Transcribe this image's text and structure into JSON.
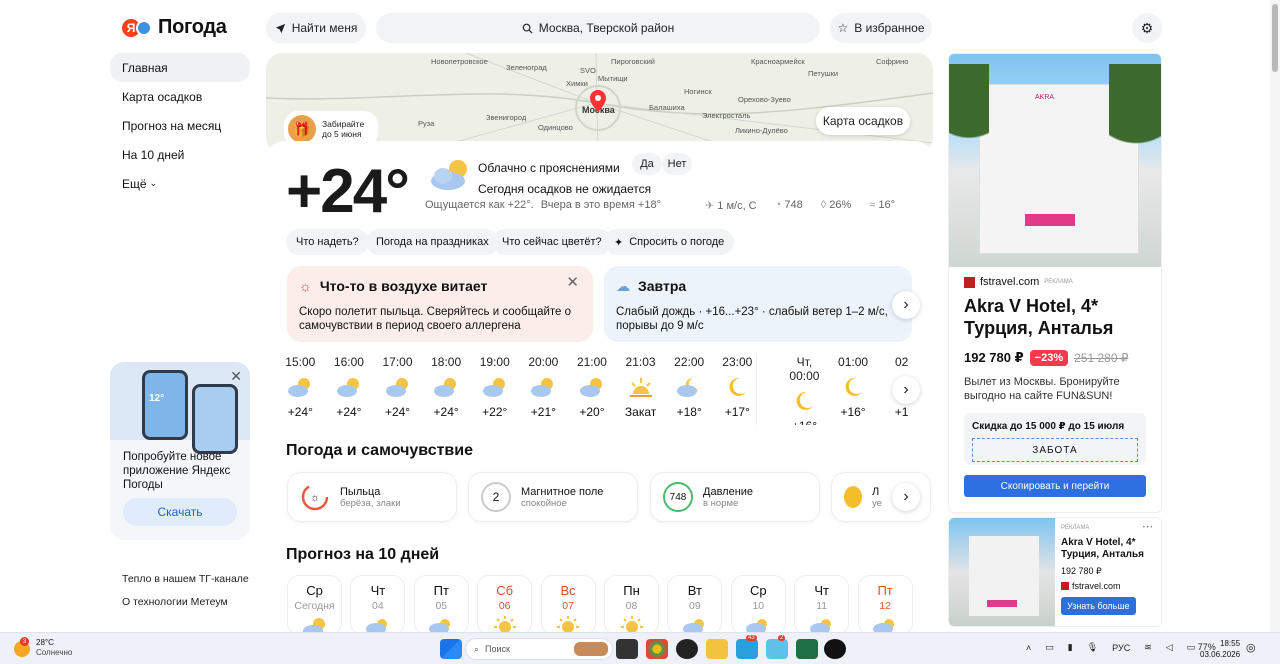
{
  "header": {
    "logo_ya": "Я",
    "logo_text": "Погода",
    "find_me": "Найти меня",
    "search_value": "Москва, Тверской район",
    "favorites": "В избранное"
  },
  "nav": {
    "items": [
      "Главная",
      "Карта осадков",
      "Прогноз на месяц",
      "На 10 дней",
      "Ещё"
    ]
  },
  "promo": {
    "phone_temp": "12°",
    "text": "Попробуйте новое приложение Яндекс Погоды",
    "button": "Скачать"
  },
  "footer_links": [
    "Тепло в нашем ТГ-канале",
    "О технологии Метеум"
  ],
  "map": {
    "labels": [
      "Новопетровское",
      "Зеленоград",
      "Пироговский",
      "Софрино",
      "Красноармейск",
      "SVO",
      "Химки",
      "Мытищи",
      "Петушки",
      "Ногинск",
      "Москва",
      "Балашиха",
      "Орехово-Зуево",
      "Руза",
      "Звенигород",
      "Одинцово",
      "Электросталь",
      "Ликино-Дулёво"
    ],
    "pin_label": "Москва",
    "button": "Карта осадков",
    "badge_text": "Забирайте до 5 июня"
  },
  "current": {
    "temp": "+24°",
    "condition": "Облачно с прояснениями",
    "yes": "Да",
    "no": "Нет",
    "precip": "Сегодня осадков не ожидается",
    "feels": "Ощущается как +22°.",
    "yesterday": "Вчера в это время +18°",
    "wind": "1 м/с, С",
    "pressure": "748",
    "humidity": "26%",
    "water": "16°"
  },
  "suggestions": [
    "Что надеть?",
    "Погода на праздниках",
    "Что сейчас цветёт?",
    "Спросить о погоде"
  ],
  "alert": {
    "title": "Что-то в воздухе витает",
    "text": "Скоро полетит пыльца. Сверяйтесь и сообщайте о самочувствии в период своего аллергена"
  },
  "tomorrow": {
    "title": "Завтра",
    "text": "Слабый дождь · +16...+23° · слабый ветер 1–2 м/с, порывы до 9 м/с"
  },
  "hourly": [
    {
      "t": "15:00",
      "v": "+24°",
      "i": "pc"
    },
    {
      "t": "16:00",
      "v": "+24°",
      "i": "pc"
    },
    {
      "t": "17:00",
      "v": "+24°",
      "i": "pc"
    },
    {
      "t": "18:00",
      "v": "+24°",
      "i": "pc"
    },
    {
      "t": "19:00",
      "v": "+22°",
      "i": "pc"
    },
    {
      "t": "20:00",
      "v": "+21°",
      "i": "pc"
    },
    {
      "t": "21:00",
      "v": "+20°",
      "i": "pc"
    },
    {
      "t": "21:03",
      "v": "Закат",
      "i": "set"
    },
    {
      "t": "22:00",
      "v": "+18°",
      "i": "npc"
    },
    {
      "t": "23:00",
      "v": "+17°",
      "i": "moon"
    },
    {
      "t": "Чт, 00:00",
      "v": "+16°",
      "i": "moon"
    },
    {
      "t": "01:00",
      "v": "+16°",
      "i": "moon"
    },
    {
      "t": "02",
      "v": "+1",
      "i": "moon"
    }
  ],
  "wellbeing": {
    "title": "Погода и самочувствие",
    "cards": [
      {
        "title": "Пыльца",
        "sub": "берёза, злаки",
        "v": ""
      },
      {
        "title": "Магнитное поле",
        "sub": "спокойное",
        "v": "2"
      },
      {
        "title": "Давление",
        "sub": "в норме",
        "v": "748"
      },
      {
        "title": "Л",
        "sub": "уе",
        "v": ""
      }
    ]
  },
  "forecast": {
    "title": "Прогноз на 10 дней",
    "days": [
      {
        "n": "Ср",
        "d": "Сегодня",
        "we": false,
        "i": "pc"
      },
      {
        "n": "Чт",
        "d": "04",
        "we": false,
        "i": "rain"
      },
      {
        "n": "Пт",
        "d": "05",
        "we": false,
        "i": "rain"
      },
      {
        "n": "Сб",
        "d": "06",
        "we": true,
        "i": "sun"
      },
      {
        "n": "Вс",
        "d": "07",
        "we": true,
        "i": "sun"
      },
      {
        "n": "Пн",
        "d": "08",
        "we": false,
        "i": "sun"
      },
      {
        "n": "Вт",
        "d": "09",
        "we": false,
        "i": "rain"
      },
      {
        "n": "Ср",
        "d": "10",
        "we": false,
        "i": "rain"
      },
      {
        "n": "Чт",
        "d": "11",
        "we": false,
        "i": "rain"
      },
      {
        "n": "Пт",
        "d": "12",
        "we": true,
        "i": "rain"
      }
    ]
  },
  "ad": {
    "sign": "AKRA",
    "source": "fstravel.com",
    "tag": "РЕКЛАМА",
    "title": "Akra V Hotel, 4* Турция, Анталья",
    "price": "192 780 ₽",
    "discount": "−23%",
    "old_price": "251 280 ₽",
    "text": "Вылет из Москвы. Бронируйте выгодно на сайте FUN&SUN!",
    "promo_title": "Скидка до 15 000 ₽ до 15 июля",
    "code": "ЗАБОТА",
    "cta": "Скопировать и перейти"
  },
  "ad2": {
    "tag": "РЕКЛАМА",
    "title": "Akra V Hotel, 4* Турция, Анталья",
    "price": "192 780 ₽",
    "source": "fstravel.com",
    "cta": "Узнать больше"
  },
  "taskbar": {
    "weather_temp": "28°C",
    "weather_text": "Солнечно",
    "badge": "3",
    "search": "Поиск",
    "badge_a": "43",
    "badge_b": "2",
    "battery": "77%",
    "lang": "РУС",
    "time": "18:55",
    "date": "03.06.2026"
  }
}
